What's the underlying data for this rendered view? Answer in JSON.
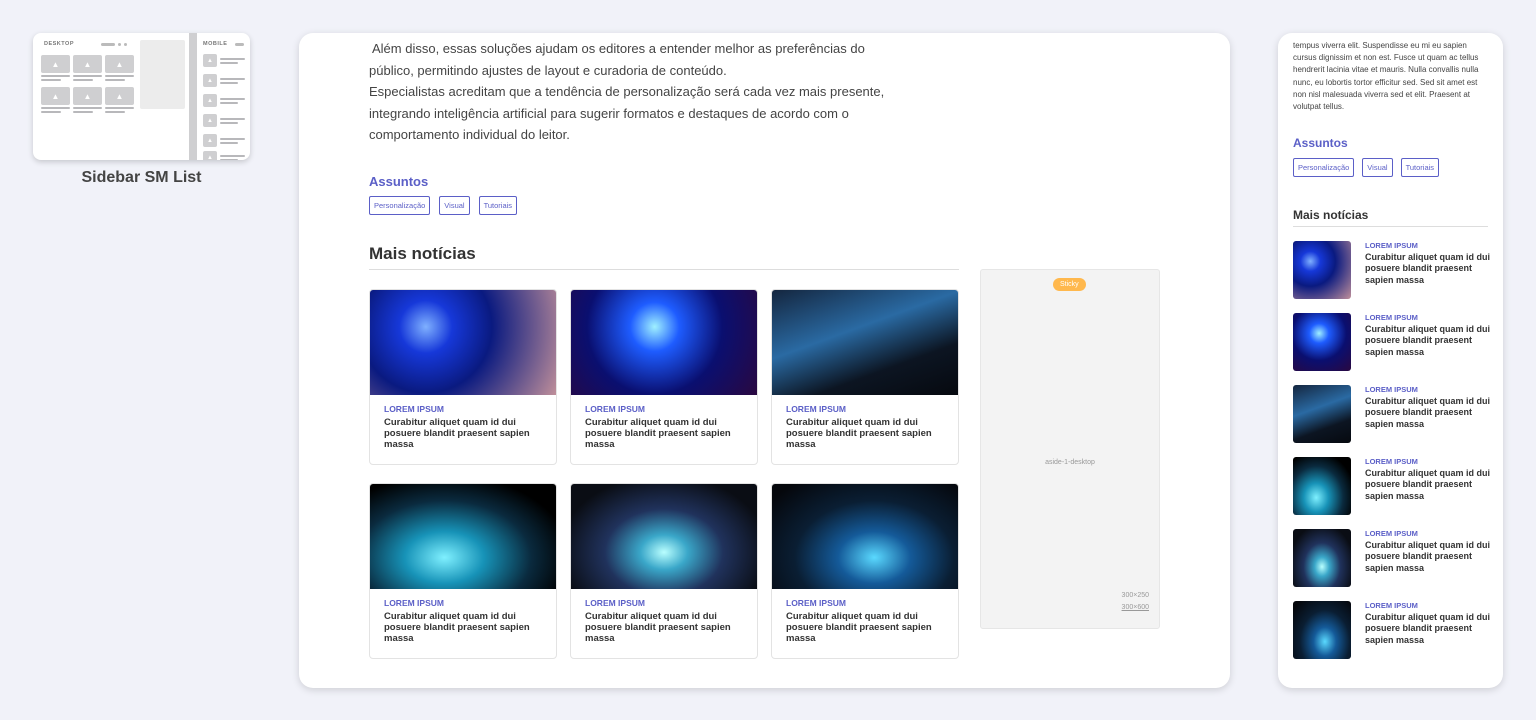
{
  "thumbnail": {
    "desktop_label": "DESKTOP",
    "mobile_label": "MOBILE",
    "caption": "Sidebar SM List"
  },
  "desktop": {
    "paragraphs": [
      "Além disso, essas soluções ajudam os editores a entender melhor as preferências do público, permitindo ajustes de layout e curadoria de conteúdo.",
      "Especialistas acreditam que a tendência de personalização será cada vez mais presente, integrando inteligência artificial para sugerir formatos e destaques de acordo com o comportamento individual do leitor."
    ],
    "assuntos_label": "Assuntos",
    "tags": [
      "Personalização",
      "Visual",
      "Tutoriais"
    ],
    "mais_noticias_title": "Mais notícias",
    "cards": [
      {
        "category": "LOREM IPSUM",
        "headline": "Curabitur aliquet quam id dui posuere blandit praesent sapien massa"
      },
      {
        "category": "LOREM IPSUM",
        "headline": "Curabitur aliquet quam id dui posuere blandit praesent sapien massa"
      },
      {
        "category": "LOREM IPSUM",
        "headline": "Curabitur aliquet quam id dui posuere blandit praesent sapien massa"
      },
      {
        "category": "LOREM IPSUM",
        "headline": "Curabitur aliquet quam id dui posuere blandit praesent sapien massa"
      },
      {
        "category": "LOREM IPSUM",
        "headline": "Curabitur aliquet quam id dui posuere blandit praesent sapien massa"
      },
      {
        "category": "LOREM IPSUM",
        "headline": "Curabitur aliquet quam id dui posuere blandit praesent sapien massa"
      }
    ],
    "aside": {
      "sticky_badge": "Sticky",
      "label": "aside-1-desktop",
      "size_1": "300×250",
      "size_2": "300×600"
    }
  },
  "mobile": {
    "paragraph": "tempus viverra elit. Suspendisse eu mi eu sapien cursus dignissim et non est. Fusce ut quam ac tellus hendrerit lacinia vitae et mauris. Nulla convallis nulla nunc, eu lobortis tortor efficitur sed. Sed sit amet est non nisl malesuada viverra sed et elit. Praesent at volutpat tellus.",
    "assuntos_label": "Assuntos",
    "tags": [
      "Personalização",
      "Visual",
      "Tutoriais"
    ],
    "mais_noticias_title": "Mais notícias",
    "items": [
      {
        "category": "LOREM IPSUM",
        "headline": "Curabitur aliquet quam id dui posuere blandit praesent sapien massa"
      },
      {
        "category": "LOREM IPSUM",
        "headline": "Curabitur aliquet quam id dui posuere blandit praesent sapien massa"
      },
      {
        "category": "LOREM IPSUM",
        "headline": "Curabitur aliquet quam id dui posuere blandit praesent sapien massa"
      },
      {
        "category": "LOREM IPSUM",
        "headline": "Curabitur aliquet quam id dui posuere blandit praesent sapien massa"
      },
      {
        "category": "LOREM IPSUM",
        "headline": "Curabitur aliquet quam id dui posuere blandit praesent sapien massa"
      },
      {
        "category": "LOREM IPSUM",
        "headline": "Curabitur aliquet quam id dui posuere blandit praesent sapien massa"
      }
    ]
  },
  "colors": {
    "accent": "#5b5fc7",
    "sticky_badge": "#ffb84d",
    "background": "#f1f2f9"
  }
}
